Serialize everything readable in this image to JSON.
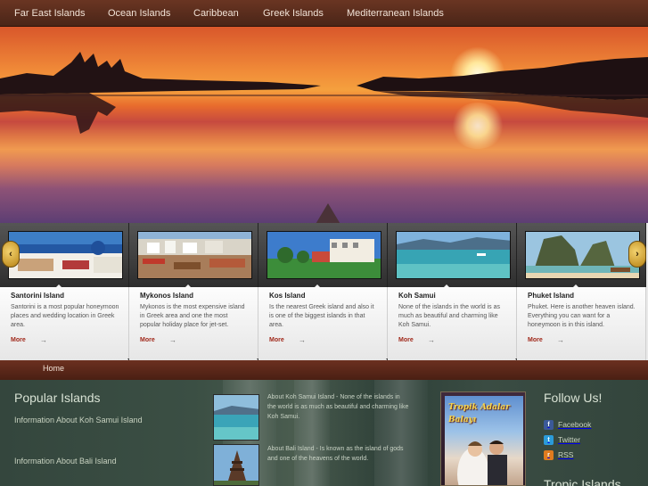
{
  "nav": {
    "items": [
      "Far East Islands",
      "Ocean Islands",
      "Caribbean",
      "Greek Islands",
      "Mediterranean Islands"
    ]
  },
  "carousel": {
    "prev_icon": "chevron-left-icon",
    "next_icon": "chevron-right-icon",
    "cards": [
      {
        "title": "Santorini Island",
        "text": "Santorini is a most popular honeymoon places and wedding location in Greek area.",
        "more": "More"
      },
      {
        "title": "Mykonos Island",
        "text": "Mykonos is the most expensive island in Greek area and one the most popular holiday place for jet-set.",
        "more": "More"
      },
      {
        "title": "Kos Island",
        "text": "Is the nearest Greek island and also it is one of the biggest islands in that area.",
        "more": "More"
      },
      {
        "title": "Koh Samui",
        "text": "None of the islands in the world is as much as beautiful and charming like Koh Samui.",
        "more": "More"
      },
      {
        "title": "Phuket Island",
        "text": "Phuket. Here is another heaven island. Everything you can want for a honeymoon is in this island.",
        "more": "More"
      }
    ]
  },
  "breadcrumb": {
    "home": "Home"
  },
  "popular": {
    "title": "Popular Islands",
    "links": [
      "Information About Koh Samui Island",
      "Information About Bali Island"
    ],
    "blurbs": [
      "About Koh Samui Island - None of the islands in the world is as much as beautiful and charming like Koh Samui.",
      "About Bali Island - Is known as the island of gods and one of the heavens of the world."
    ]
  },
  "poster": {
    "title_line1": "Tropik Adalar",
    "title_line2": "Balayı"
  },
  "follow": {
    "title": "Follow Us!",
    "items": [
      {
        "label": "Facebook",
        "icon": "facebook-icon",
        "color": "#3b5998",
        "glyph": "f"
      },
      {
        "label": "Twitter",
        "icon": "twitter-icon",
        "color": "#2b9bd8",
        "glyph": "t"
      },
      {
        "label": "RSS",
        "icon": "rss-icon",
        "color": "#e07b1f",
        "glyph": "r"
      }
    ]
  },
  "tropic": {
    "title": "Tropic Islands"
  }
}
